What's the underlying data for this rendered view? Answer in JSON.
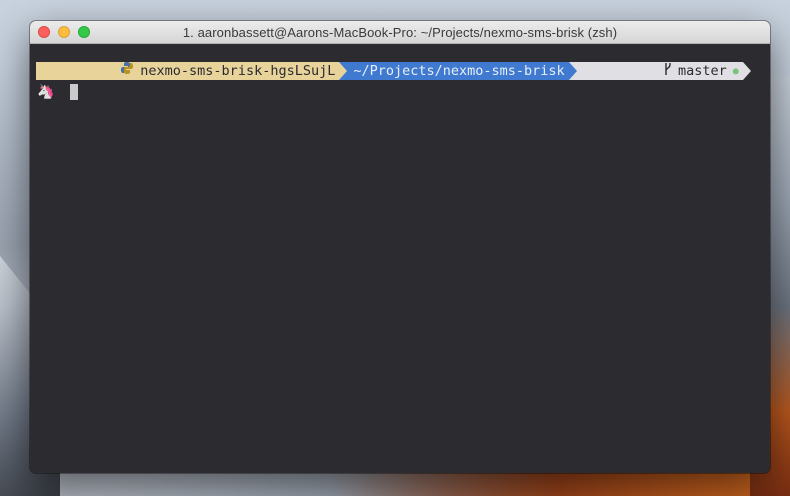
{
  "window": {
    "title": "1. aaronbassett@Aarons-MacBook-Pro: ~/Projects/nexmo-sms-brisk (zsh)"
  },
  "prompt": {
    "venv": {
      "label": "nexmo-sms-brisk-hgsLSujL",
      "icon": "python-icon"
    },
    "path": {
      "label": "~/Projects/nexmo-sms-brisk"
    },
    "git": {
      "branch": "master",
      "icon": "git-branch-icon",
      "status_icon": "dirty-indicator-icon"
    },
    "input_prefix_icon": "unicorn-icon",
    "colors": {
      "venv": "#e8d39a",
      "path": "#3f7ad0",
      "git": "#e0e0e4",
      "background": "#2b2b30"
    }
  }
}
